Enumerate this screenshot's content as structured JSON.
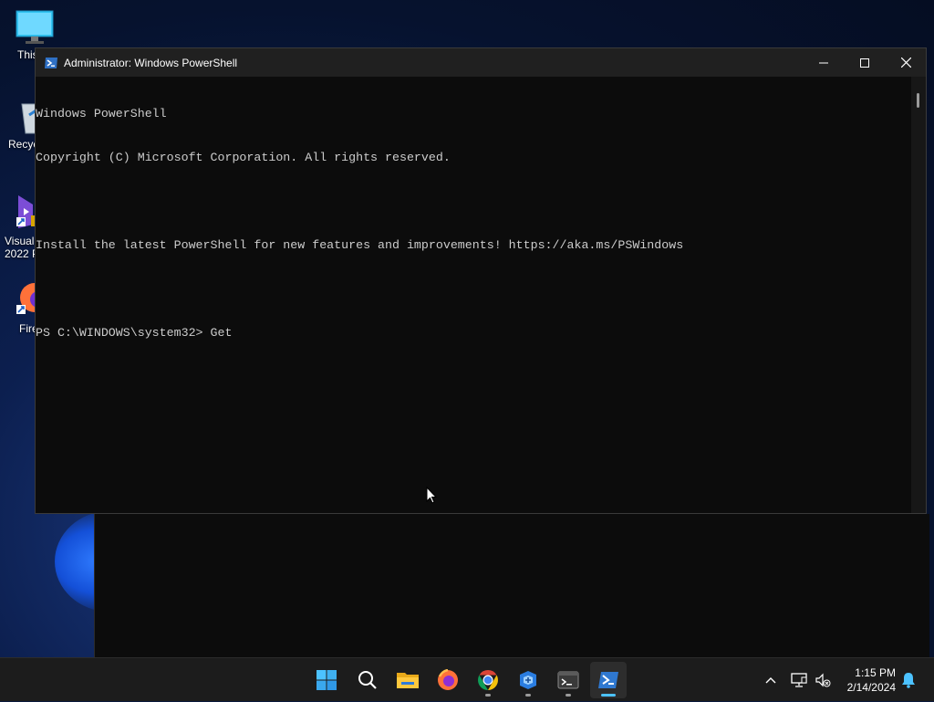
{
  "desktop": {
    "icons": [
      {
        "label": "This",
        "icon": "this-pc-icon"
      },
      {
        "label": "Recyc",
        "icon": "recycle-bin-icon"
      },
      {
        "label": "Visual\n2022 P",
        "icon": "visual-studio-icon"
      },
      {
        "label": "Fire",
        "icon": "firefox-icon"
      }
    ]
  },
  "window": {
    "title": "Administrator: Windows PowerShell",
    "controls": {
      "minimize": "minimize-icon",
      "maximize": "maximize-icon",
      "close": "close-icon"
    }
  },
  "console": {
    "lines": [
      "Windows PowerShell",
      "Copyright (C) Microsoft Corporation. All rights reserved.",
      "",
      "Install the latest PowerShell for new features and improvements! https://aka.ms/PSWindows",
      "",
      "PS C:\\WINDOWS\\system32> Get"
    ]
  },
  "taskbar": {
    "apps": [
      {
        "name": "start",
        "icon": "windows-start-icon"
      },
      {
        "name": "search",
        "icon": "search-icon"
      },
      {
        "name": "file-explorer",
        "icon": "file-explorer-icon"
      },
      {
        "name": "firefox",
        "icon": "firefox-icon"
      },
      {
        "name": "chrome",
        "icon": "chrome-icon"
      },
      {
        "name": "app",
        "icon": "app-icon"
      },
      {
        "name": "terminal",
        "icon": "terminal-icon"
      },
      {
        "name": "powershell",
        "icon": "powershell-icon"
      }
    ],
    "tray": {
      "chevron": "chevron-up-icon",
      "network": "network-icon",
      "volume": "volume-muted-icon",
      "notifications": "bell-icon"
    },
    "time": "1:15 PM",
    "date": "2/14/2024"
  },
  "colors": {
    "accent": "#4cc2ff",
    "console_bg": "#0c0c0c",
    "console_fg": "#cccccc"
  }
}
